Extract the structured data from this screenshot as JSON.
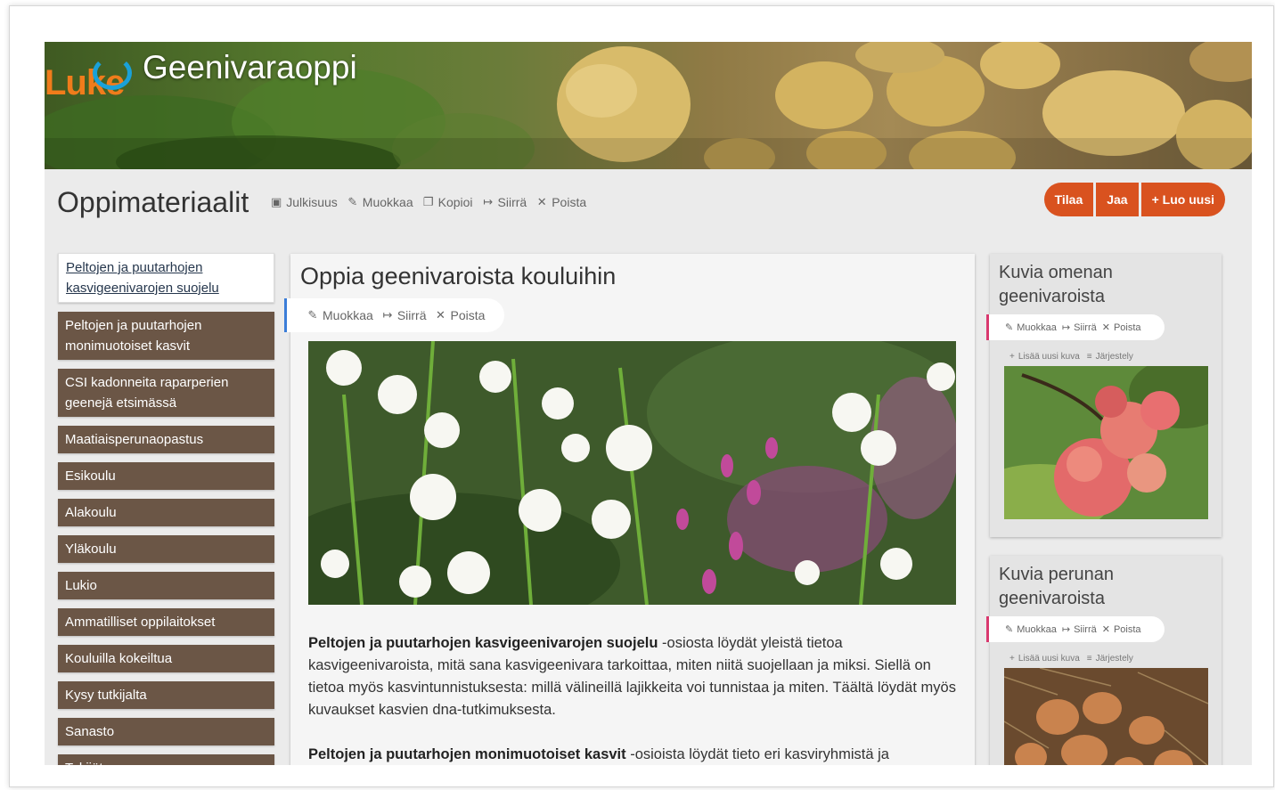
{
  "site": {
    "logo_text": "Luke",
    "title": "Geenivaraoppi"
  },
  "header": {
    "page_title": "Oppimateriaalit",
    "toolbar": [
      {
        "icon": "lock-icon",
        "label": "Julkisuus"
      },
      {
        "icon": "pencil-icon",
        "label": "Muokkaa"
      },
      {
        "icon": "copy-icon",
        "label": "Kopioi"
      },
      {
        "icon": "move-icon",
        "label": "Siirrä"
      },
      {
        "icon": "close-icon",
        "label": "Poista"
      }
    ],
    "buttons": {
      "subscribe": "Tilaa",
      "share": "Jaa",
      "create_new": "Luo uusi"
    }
  },
  "nav": {
    "items": [
      {
        "label": "Peltojen ja puutarhojen kasvigeenivarojen suojelu",
        "active": true
      },
      {
        "label": "Peltojen ja puutarhojen monimuotoiset kasvit"
      },
      {
        "label": "CSI kadonneita raparperien geenejä etsimässä"
      },
      {
        "label": "Maatiaisperunaopastus"
      },
      {
        "label": "Esikoulu"
      },
      {
        "label": "Alakoulu"
      },
      {
        "label": "Yläkoulu"
      },
      {
        "label": "Lukio"
      },
      {
        "label": "Ammatilliset oppilaitokset"
      },
      {
        "label": "Kouluilla kokeiltua"
      },
      {
        "label": "Kysy tutkijalta"
      },
      {
        "label": "Sanasto"
      },
      {
        "label": "Tekijät"
      }
    ]
  },
  "main": {
    "title": "Oppia geenivaroista kouluihin",
    "toolbar": [
      {
        "icon": "pencil-icon",
        "label": "Muokkaa"
      },
      {
        "icon": "move-icon",
        "label": "Siirrä"
      },
      {
        "icon": "close-icon",
        "label": "Poista"
      }
    ],
    "image_alt": "lilies-photo",
    "paragraph1_bold": "Peltojen ja puutarhojen kasvigeenivarojen suojelu",
    "paragraph1_text": " -osiosta löydät yleistä tietoa kasvigeenivaroista, mitä sana kasvigeenivara tarkoittaa, miten niitä suojellaan ja miksi. Siellä on tietoa myös kasvintunnistuksesta: millä välineillä lajikkeita voi tunnistaa ja miten. Täältä löydät myös kuvaukset kasvien dna-tutkimuksesta.",
    "paragraph2_bold": "Peltojen ja puutarhojen monimuotoiset kasvit",
    "paragraph2_text": " -osioista löydät tieto eri kasviryhmistä ja"
  },
  "cards": [
    {
      "title_line1": "Kuvia omenan",
      "title_line2": "geenivaroista",
      "toolbar": {
        "edit": "Muokkaa",
        "move": "Siirrä",
        "delete": "Poista"
      },
      "add_image": "Lisää uusi kuva",
      "arrange": "Järjestely"
    },
    {
      "title_line1": "Kuvia perunan",
      "title_line2": "geenivaroista",
      "toolbar": {
        "edit": "Muokkaa",
        "move": "Siirrä",
        "delete": "Poista"
      },
      "add_image": "Lisää uusi kuva",
      "arrange": "Järjestely"
    }
  ],
  "colors": {
    "accent_orange": "#d9521f",
    "nav_brown": "#6b5646",
    "edit_bar_blue": "#3b7dd8",
    "edit_bar_pink": "#d9386e"
  }
}
